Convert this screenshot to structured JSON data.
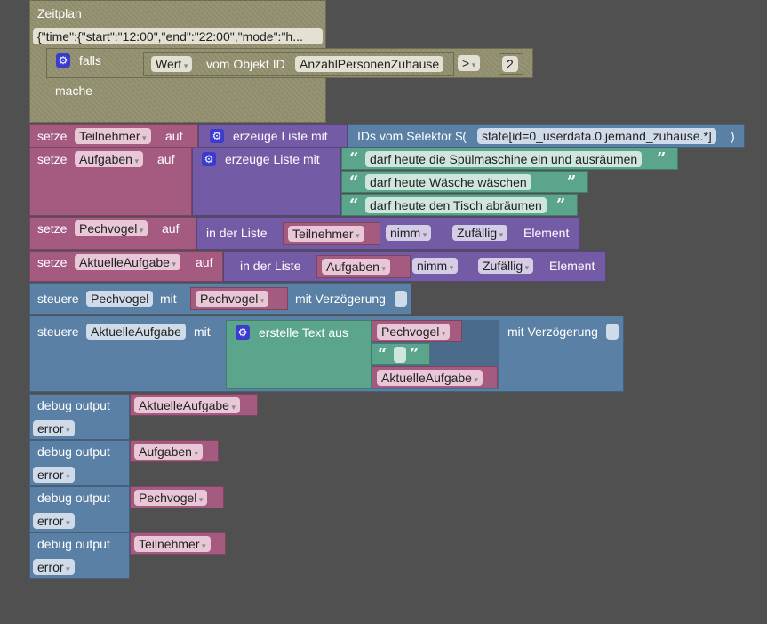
{
  "trigger": {
    "title": "Zeitplan",
    "schedule": "{\"time\":{\"start\":\"12:00\",\"end\":\"22:00\",\"mode\":\"h...",
    "if_label": "falls",
    "do_label": "mache",
    "value_field": "Wert",
    "object_label": "vom Objekt ID",
    "object_id": "AnzahlPersonenZuhause",
    "operator": ">",
    "compare_value": "2"
  },
  "labels": {
    "set": "setze",
    "to": "auf",
    "create_list": "erzeuge Liste mit",
    "ids_selector": "IDs vom Selektor $(",
    "close_paren": ")",
    "in_list": "in der Liste",
    "take": "nimm",
    "random": "Zufällig",
    "element": "Element",
    "control": "steuere",
    "with": "mit",
    "delay": "mit Verzögerung",
    "create_text": "erstelle Text aus",
    "debug": "debug output",
    "level": "error",
    "quote_open": "“",
    "quote_close": "”"
  },
  "set1": {
    "var": "Teilnehmer",
    "selector": "state[id=0_userdata.0.jemand_zuhause.*]"
  },
  "set2": {
    "var": "Aufgaben",
    "items": [
      "darf heute die Spülmaschine ein und ausräumen",
      "darf heute Wäsche wäschen",
      "darf heute den Tisch abräumen"
    ]
  },
  "set3": {
    "var": "Pechvogel",
    "list": "Teilnehmer"
  },
  "set4": {
    "var": "AktuelleAufgabe",
    "list": "Aufgaben"
  },
  "ctrl1": {
    "state": "Pechvogel",
    "value": "Pechvogel"
  },
  "ctrl2": {
    "state": "AktuelleAufgabe",
    "parts": [
      "Pechvogel",
      "AktuelleAufgabe"
    ]
  },
  "debug": [
    "AktuelleAufgabe",
    "Aufgaben",
    "Pechvogel",
    "Teilnehmer"
  ]
}
